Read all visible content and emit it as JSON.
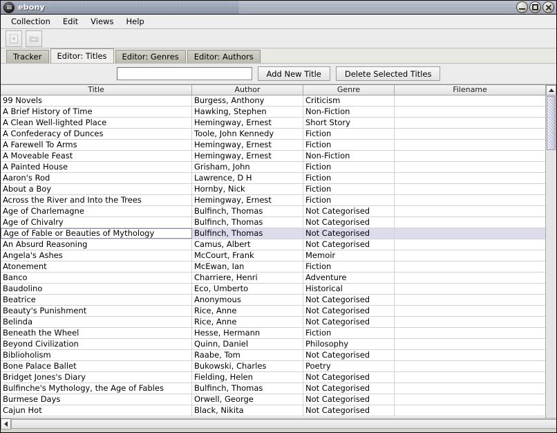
{
  "window": {
    "title": "ebony",
    "app_icon": "list-menu-icon",
    "controls": {
      "minimize": "minimize-icon",
      "maximize": "maximize-icon",
      "close": "close-icon"
    }
  },
  "menubar": {
    "items": [
      {
        "label": "Collection"
      },
      {
        "label": "Edit"
      },
      {
        "label": "Views"
      },
      {
        "label": "Help"
      }
    ]
  },
  "toolbar": {
    "buttons": [
      {
        "icon": "new-document-icon",
        "enabled": false
      },
      {
        "icon": "open-folder-icon",
        "enabled": false
      }
    ]
  },
  "tabs": [
    {
      "label": "Tracker",
      "active": false
    },
    {
      "label": "Editor: Titles",
      "active": true
    },
    {
      "label": "Editor: Genres",
      "active": false
    },
    {
      "label": "Editor: Authors",
      "active": false
    }
  ],
  "actionbar": {
    "search_value": "",
    "search_placeholder": "",
    "add_button": "Add New Title",
    "delete_button": "Delete Selected Titles"
  },
  "table": {
    "columns": [
      "Title",
      "Author",
      "Genre",
      "Filename"
    ],
    "selected_row_index": 12,
    "rows": [
      {
        "title": "99 Novels",
        "author": "Burgess, Anthony",
        "genre": "Criticism",
        "filename": ""
      },
      {
        "title": "A Brief History of Time",
        "author": "Hawking, Stephen",
        "genre": "Non-Fiction",
        "filename": ""
      },
      {
        "title": "A Clean Well-lighted Place",
        "author": "Hemingway, Ernest",
        "genre": "Short Story",
        "filename": ""
      },
      {
        "title": "A Confederacy of Dunces",
        "author": "Toole, John Kennedy",
        "genre": "Fiction",
        "filename": ""
      },
      {
        "title": "A Farewell To Arms",
        "author": "Hemingway, Ernest",
        "genre": "Fiction",
        "filename": ""
      },
      {
        "title": "A Moveable Feast",
        "author": "Hemingway, Ernest",
        "genre": "Non-Fiction",
        "filename": ""
      },
      {
        "title": "A Painted House",
        "author": "Grisham, John",
        "genre": "Fiction",
        "filename": ""
      },
      {
        "title": "Aaron's Rod",
        "author": "Lawrence, D H",
        "genre": "Fiction",
        "filename": ""
      },
      {
        "title": "About a Boy",
        "author": "Hornby, Nick",
        "genre": "Fiction",
        "filename": ""
      },
      {
        "title": "Across the River and Into the Trees",
        "author": "Hemingway, Ernest",
        "genre": "Fiction",
        "filename": ""
      },
      {
        "title": "Age of Charlemagne",
        "author": "Bulfinch, Thomas",
        "genre": "Not Categorised",
        "filename": ""
      },
      {
        "title": "Age of Chivalry",
        "author": "Bulfinch, Thomas",
        "genre": "Not Categorised",
        "filename": ""
      },
      {
        "title": "Age of Fable or Beauties of Mythology",
        "author": "Bulfinch, Thomas",
        "genre": "Not Categorised",
        "filename": ""
      },
      {
        "title": "An Absurd Reasoning",
        "author": "Camus, Albert",
        "genre": "Not Categorised",
        "filename": ""
      },
      {
        "title": "Angela's Ashes",
        "author": "McCourt, Frank",
        "genre": "Memoir",
        "filename": ""
      },
      {
        "title": "Atonement",
        "author": "McEwan, Ian",
        "genre": "Fiction",
        "filename": ""
      },
      {
        "title": "Banco",
        "author": "Charriere, Henri",
        "genre": "Adventure",
        "filename": ""
      },
      {
        "title": "Baudolino",
        "author": "Eco, Umberto",
        "genre": "Historical",
        "filename": ""
      },
      {
        "title": "Beatrice",
        "author": "Anonymous",
        "genre": "Not Categorised",
        "filename": ""
      },
      {
        "title": "Beauty's Punishment",
        "author": "Rice, Anne",
        "genre": "Not Categorised",
        "filename": ""
      },
      {
        "title": "Belinda",
        "author": "Rice, Anne",
        "genre": "Not Categorised",
        "filename": ""
      },
      {
        "title": "Beneath the Wheel",
        "author": "Hesse, Hermann",
        "genre": "Fiction",
        "filename": ""
      },
      {
        "title": "Beyond Civilization",
        "author": "Quinn, Daniel",
        "genre": "Philosophy",
        "filename": ""
      },
      {
        "title": "Biblioholism",
        "author": "Raabe, Tom",
        "genre": "Not Categorised",
        "filename": ""
      },
      {
        "title": "Bone Palace Ballet",
        "author": "Bukowski, Charles",
        "genre": "Poetry",
        "filename": ""
      },
      {
        "title": "Bridget Jones's Diary",
        "author": "Fielding, Helen",
        "genre": "Not Categorised",
        "filename": ""
      },
      {
        "title": "Bulfinche's Mythology, the Age of Fables",
        "author": "Bulfinch, Thomas",
        "genre": "Not Categorised",
        "filename": ""
      },
      {
        "title": "Burmese Days",
        "author": "Orwell, George",
        "genre": "Not Categorised",
        "filename": ""
      },
      {
        "title": "Cajun Hot",
        "author": "Black, Nikita",
        "genre": "Not Categorised",
        "filename": ""
      }
    ]
  },
  "colors": {
    "selection": "#dcdcec",
    "titlebar": "#848d9e",
    "window_bg": "#d6d3cb"
  }
}
